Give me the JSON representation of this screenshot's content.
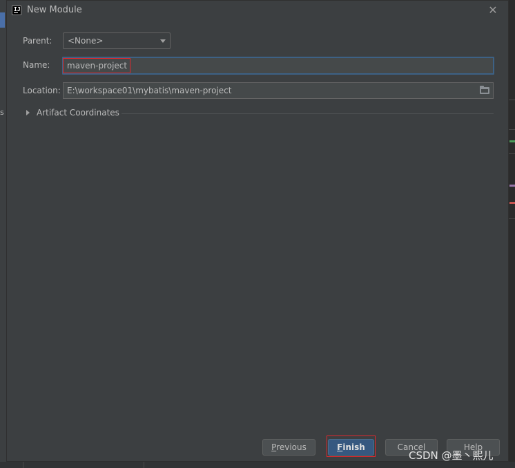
{
  "window": {
    "title": "New Module"
  },
  "form": {
    "parent_label": "Parent:",
    "parent_value": "<None>",
    "name_label": "Name:",
    "name_value": "maven-project",
    "location_label": "Location:",
    "location_value": "E:\\workspace01\\mybatis\\maven-project",
    "artifact_label": "Artifact Coordinates"
  },
  "buttons": {
    "previous": {
      "key": "P",
      "rest": "revious"
    },
    "finish": {
      "key": "F",
      "rest": "inish"
    },
    "cancel": "Cancel",
    "help": "Help"
  },
  "watermark": "CSDN @墨丶熙儿",
  "background": {
    "left_label": "s"
  },
  "colors": {
    "dialog_bg": "#3c3f41",
    "focus_border": "#3d6185",
    "highlight": "#e0282f",
    "default_button": "#365880"
  },
  "icons": [
    "app-icon",
    "close-icon",
    "chevron-down-icon",
    "folder-icon",
    "expand-arrow-icon"
  ]
}
